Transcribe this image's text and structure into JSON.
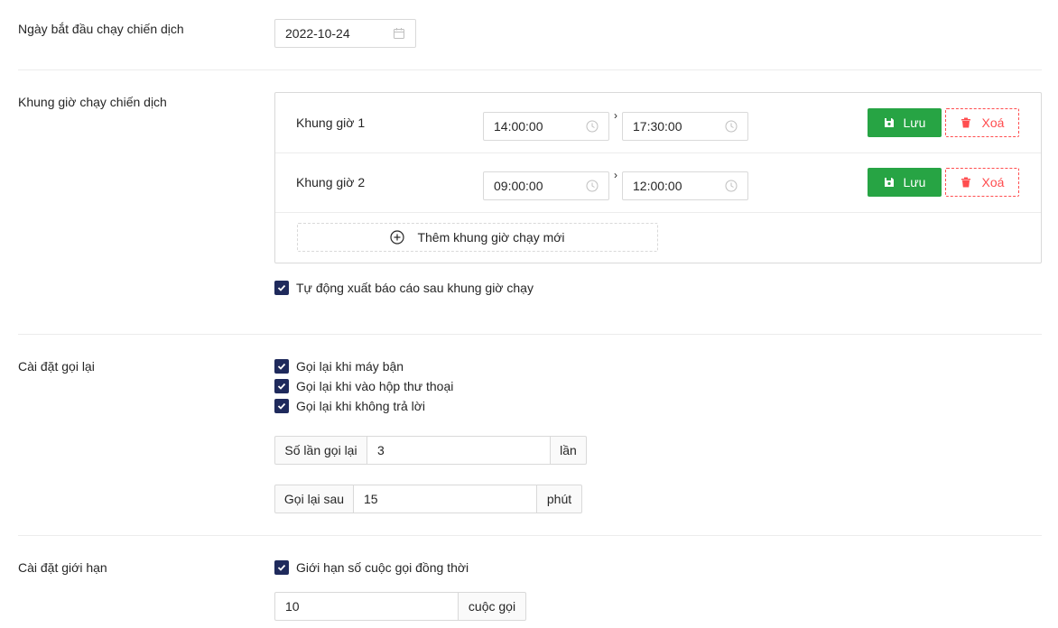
{
  "start_date": {
    "label": "Ngày bắt đầu chạy chiến dịch",
    "value": "2022-10-24"
  },
  "time_frames": {
    "label": "Khung giờ chạy chiến dịch",
    "rows": [
      {
        "name": "Khung giờ 1",
        "start": "14:00:00",
        "end": "17:30:00"
      },
      {
        "name": "Khung giờ 2",
        "start": "09:00:00",
        "end": "12:00:00"
      }
    ],
    "save_label": "Lưu",
    "delete_label": "Xoá",
    "add_label": "Thêm khung giờ chạy mới",
    "auto_report_label": "Tự động xuất báo cáo sau khung giờ chạy"
  },
  "recall": {
    "label": "Cài đặt gọi lại",
    "options": [
      "Gọi lại khi máy bận",
      "Gọi lại khi vào hộp thư thoại",
      "Gọi lại khi không trả lời"
    ],
    "retry_count": {
      "prefix": "Số lần gọi lại",
      "value": "3",
      "suffix": "lần"
    },
    "retry_after": {
      "prefix": "Gọi lại sau",
      "value": "15",
      "suffix": "phút"
    }
  },
  "limit": {
    "label": "Cài đặt giới hạn",
    "option": "Giới hạn số cuộc gọi đồng thời",
    "value": "10",
    "suffix": "cuộc gọi"
  },
  "colors": {
    "primary_check": "#1f2a5c",
    "save_green": "#27a444",
    "delete_red": "#ff4d4f"
  }
}
